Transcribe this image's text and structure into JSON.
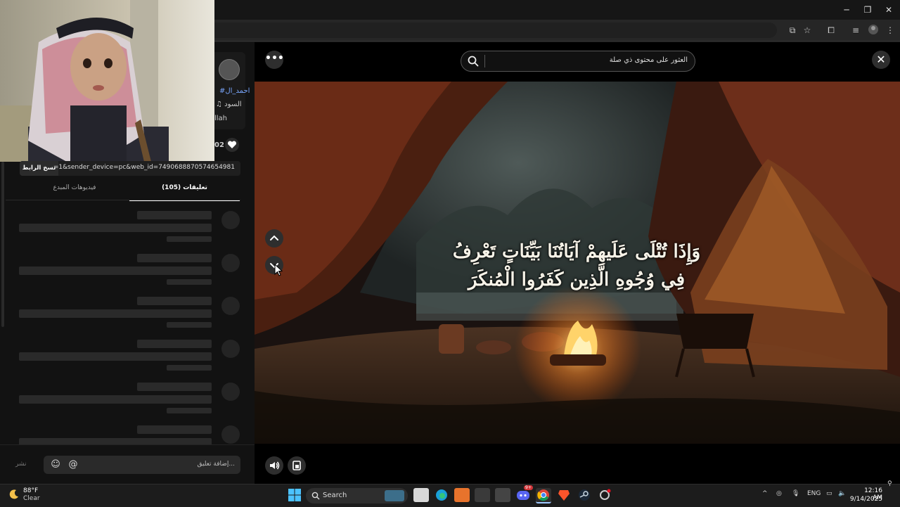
{
  "browser": {
    "window_controls": {
      "minimize": "─",
      "maximize": "❐",
      "close": "✕"
    }
  },
  "creator": {
    "hashtag": "#احمد_ال",
    "sound": "♫ السود",
    "user": "llah",
    "likes": "02"
  },
  "share": {
    "link": "...=1&sender_device=pc&web_id=7490688870574654981",
    "copy_label": "نسخ الرابط"
  },
  "tabs": {
    "comments": "(105) تعليقات",
    "creator_videos": "فيديوهات المبدع"
  },
  "comment_box": {
    "placeholder": "إضافة تعليق...",
    "post": "نشر"
  },
  "search": {
    "placeholder": "العثور على محتوى ذي صلة"
  },
  "video": {
    "caption_line1": "وَإِذَا تُتْلَى عَلَيهِمْ آيَاتُنَا بَيِّنَاتٍ تَعْرِفُ",
    "caption_line2": "فِي وُجُوهِ الَّذِين كَفَرُوا الْمُنكَرَ"
  },
  "taskbar": {
    "weather_temp": "88°F",
    "weather_desc": "Clear",
    "search_label": "Search",
    "language": "ENG",
    "time": "12:16 AM",
    "date": "9/14/2025",
    "discord_badge": "9+"
  },
  "colors": {
    "accent_blue": "#7aa7ff",
    "cave": "#6a2b16",
    "fire": "#ffb347"
  }
}
